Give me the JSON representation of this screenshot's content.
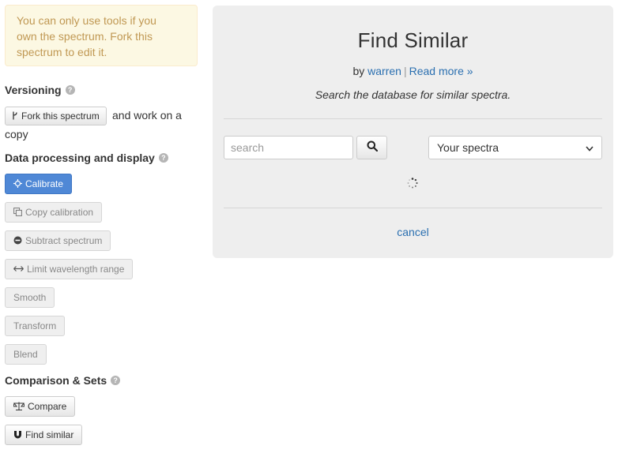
{
  "sidebar": {
    "alert_line1": "You can only use tools if you",
    "alert_line2": "own the spectrum. Fork this",
    "alert_line3": "spectrum to edit it.",
    "versioning_heading": "Versioning",
    "fork_button_label": "Fork this spectrum",
    "fork_text_line1": "and work on a",
    "fork_text_line2": "copy",
    "processing_heading": "Data processing and display",
    "tools": [
      {
        "label": "Calibrate",
        "icon": "crosshair-icon",
        "state": "primary"
      },
      {
        "label": "Copy calibration",
        "icon": "copy-icon",
        "state": "disabled"
      },
      {
        "label": "Subtract spectrum",
        "icon": "minus-circle-icon",
        "state": "disabled"
      },
      {
        "label": "Limit wavelength range",
        "icon": "arrows-horizontal-icon",
        "state": "disabled"
      },
      {
        "label": "Smooth",
        "icon": "",
        "state": "disabled"
      },
      {
        "label": "Transform",
        "icon": "",
        "state": "disabled"
      },
      {
        "label": "Blend",
        "icon": "",
        "state": "disabled"
      }
    ],
    "comparison_heading": "Comparison & Sets",
    "compare_label": "Compare",
    "find_similar_label": "Find similar",
    "help_glyph": "?"
  },
  "panel": {
    "title": "Find Similar",
    "by_prefix": "by",
    "author": "warren",
    "read_more": "Read more »",
    "description": "Search the database for similar spectra.",
    "search_placeholder": "search",
    "search_value": "",
    "select_value": "Your spectra",
    "cancel_label": "cancel"
  },
  "colors": {
    "alert_bg": "#fcf8e3",
    "alert_text": "#c09853",
    "primary_button": "#4f88d6",
    "panel_bg": "#eeeeee",
    "link": "#2a6fb0"
  }
}
